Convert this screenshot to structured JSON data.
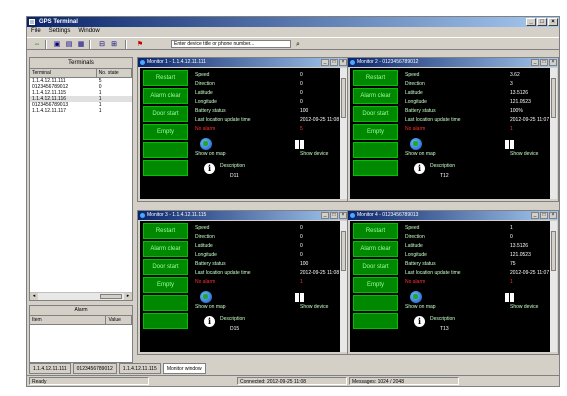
{
  "app": {
    "title": "GPS Terminal"
  },
  "window_controls": {
    "min": "_",
    "max": "□",
    "close": "×"
  },
  "menu": [
    "File",
    "Settings",
    "Window"
  ],
  "toolbar": {
    "search_placeholder": "Enter device title or phone number..."
  },
  "left_panel": {
    "title": "Terminals",
    "columns": [
      "Terminal",
      "No. state"
    ],
    "rows": [
      [
        "1.1.4.12.11.111",
        "5"
      ],
      [
        "0123456789012",
        "0"
      ],
      [
        "1.1.4.12.11.115",
        "1"
      ],
      [
        "1.1.4.12.11.116",
        "1"
      ],
      [
        "0123456789013",
        "1"
      ],
      [
        "1.1.4.12.11.117",
        "1"
      ]
    ],
    "selected_row": 3
  },
  "lower_panel": {
    "title": "Alarm",
    "columns": [
      "Item",
      "Value"
    ]
  },
  "monitor_buttons": [
    "Restart",
    "Alarm clear",
    "Door start",
    "Empty",
    "",
    ""
  ],
  "field_labels": [
    "Speed",
    "Direction",
    "Latitude",
    "Longitude",
    "Battery status",
    "Last location update time"
  ],
  "monitors": [
    {
      "title": "Monitor 1 - 1.1.4.12.11.111",
      "values": [
        "0",
        "0",
        "0",
        "0",
        "100",
        "2012-09-25 11:08"
      ],
      "alarm_label": "No alarm",
      "alarm_value": "5",
      "map_label": "Show on map",
      "map_value": "Show device",
      "desc_label": "Description",
      "desc_value": "D11"
    },
    {
      "title": "Monitor 2 - 0123456789012",
      "values": [
        "3.62",
        "3",
        "13.5126",
        "121.0523",
        "100%",
        "2012-09-25 11:07"
      ],
      "alarm_label": "No alarm",
      "alarm_value": "1",
      "map_label": "Show on map",
      "map_value": "Show device",
      "desc_label": "Description",
      "desc_value": "T12"
    },
    {
      "title": "Monitor 3 - 1.1.4.12.11.115",
      "values": [
        "0",
        "0",
        "0",
        "0",
        "100",
        "2012-09-25 11:08"
      ],
      "alarm_label": "No alarm",
      "alarm_value": "1",
      "map_label": "Show on map",
      "map_value": "Show device",
      "desc_label": "Description",
      "desc_value": "D15"
    },
    {
      "title": "Monitor 4 - 0123456789013",
      "values": [
        "1",
        "0",
        "13.5126",
        "121.0523",
        "75",
        "2012-09-25 11:07"
      ],
      "alarm_label": "No alarm",
      "alarm_value": "1",
      "map_label": "Show on map",
      "map_value": "Show device",
      "desc_label": "Description",
      "desc_value": "T13"
    }
  ],
  "tabs": [
    "1.1.4.12.11.111",
    "0123456789012",
    "1.1.4.12.11.115",
    "Monitor window"
  ],
  "status": {
    "left": "Ready",
    "middle": "Connected: 2012-09-25 11:08",
    "right": "Messages: 1024 / 2048"
  }
}
